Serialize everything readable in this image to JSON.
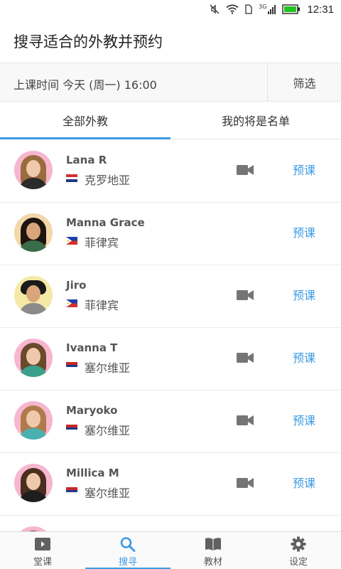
{
  "status_bar": {
    "time": "12:31",
    "network": "3G",
    "icons": [
      "mute-icon",
      "wifi-icon",
      "sim-icon",
      "signal-icon",
      "battery-icon"
    ],
    "battery_color": "#22c322"
  },
  "header": {
    "title": "搜寻适合的外教并预约"
  },
  "filter_bar": {
    "class_time": "上课时间 今天 (周一) 16:00",
    "filter_label": "筛选"
  },
  "tabs": [
    {
      "label": "全部外教",
      "active": true
    },
    {
      "label": "我的将是名单",
      "active": false
    }
  ],
  "teachers": [
    {
      "name": "Lana R",
      "country": "克罗地亚",
      "flag": "croatia-flag",
      "has_video": true,
      "book_label": "预课"
    },
    {
      "name": "Manna Grace",
      "country": "菲律宾",
      "flag": "philippines-flag",
      "has_video": false,
      "book_label": "预课"
    },
    {
      "name": "Jiro",
      "country": "菲律宾",
      "flag": "philippines-flag",
      "has_video": true,
      "book_label": "预课"
    },
    {
      "name": "Ivanna T",
      "country": "塞尔维亚",
      "flag": "serbia-flag",
      "has_video": true,
      "book_label": "预课"
    },
    {
      "name": "Maryoko",
      "country": "塞尔维亚",
      "flag": "serbia-flag",
      "has_video": true,
      "book_label": "预课"
    },
    {
      "name": "Millica M",
      "country": "塞尔维亚",
      "flag": "serbia-flag",
      "has_video": true,
      "book_label": "预课"
    }
  ],
  "bottom_nav": [
    {
      "label": "堂课",
      "icon": "video-camera-icon",
      "active": false
    },
    {
      "label": "搜寻",
      "icon": "search-icon",
      "active": true
    },
    {
      "label": "教材",
      "icon": "book-icon",
      "active": false
    },
    {
      "label": "设定",
      "icon": "gear-icon",
      "active": false
    }
  ],
  "colors": {
    "accent": "#3d9ae3",
    "icon_gray": "#757575"
  }
}
